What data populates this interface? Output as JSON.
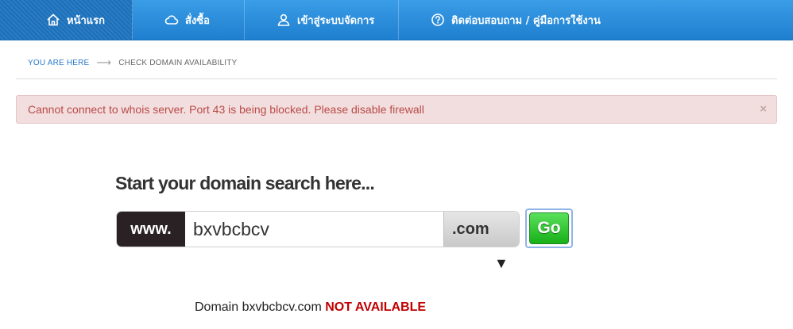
{
  "nav": {
    "items": [
      {
        "label": "หน้าแรก",
        "icon": "home-icon",
        "active": true
      },
      {
        "label": "สั่งซื้อ",
        "icon": "cloud-icon",
        "active": false
      },
      {
        "label": "เข้าสู่ระบบจัดการ",
        "icon": "user-icon",
        "active": false
      },
      {
        "label": "ติดต่อบสอบถาม / คู่มือการใช้งาน",
        "icon": "help-circle-icon",
        "active": false
      }
    ]
  },
  "breadcrumb": {
    "home": "YOU ARE HERE",
    "separator": "⟶",
    "current": "CHECK DOMAIN AVAILABILITY"
  },
  "alert": {
    "message": "Cannot connect to whois server. Port 43 is being blocked. Please disable firewall",
    "close": "×"
  },
  "search": {
    "heading": "Start your domain search here...",
    "prefix": "www.",
    "value": "bxvbcbcv",
    "tld": ".com",
    "tld_arrow": "▼",
    "go_label": "Go"
  },
  "result": {
    "prefix": "Domain",
    "domain": "bxvbcbcv.com",
    "status": "NOT AVAILABLE"
  },
  "colors": {
    "nav": "#2a8ad9",
    "alert_bg": "#f2dede",
    "alert_text": "#b94a48",
    "go": "#22b522",
    "not_available": "#c00000"
  }
}
